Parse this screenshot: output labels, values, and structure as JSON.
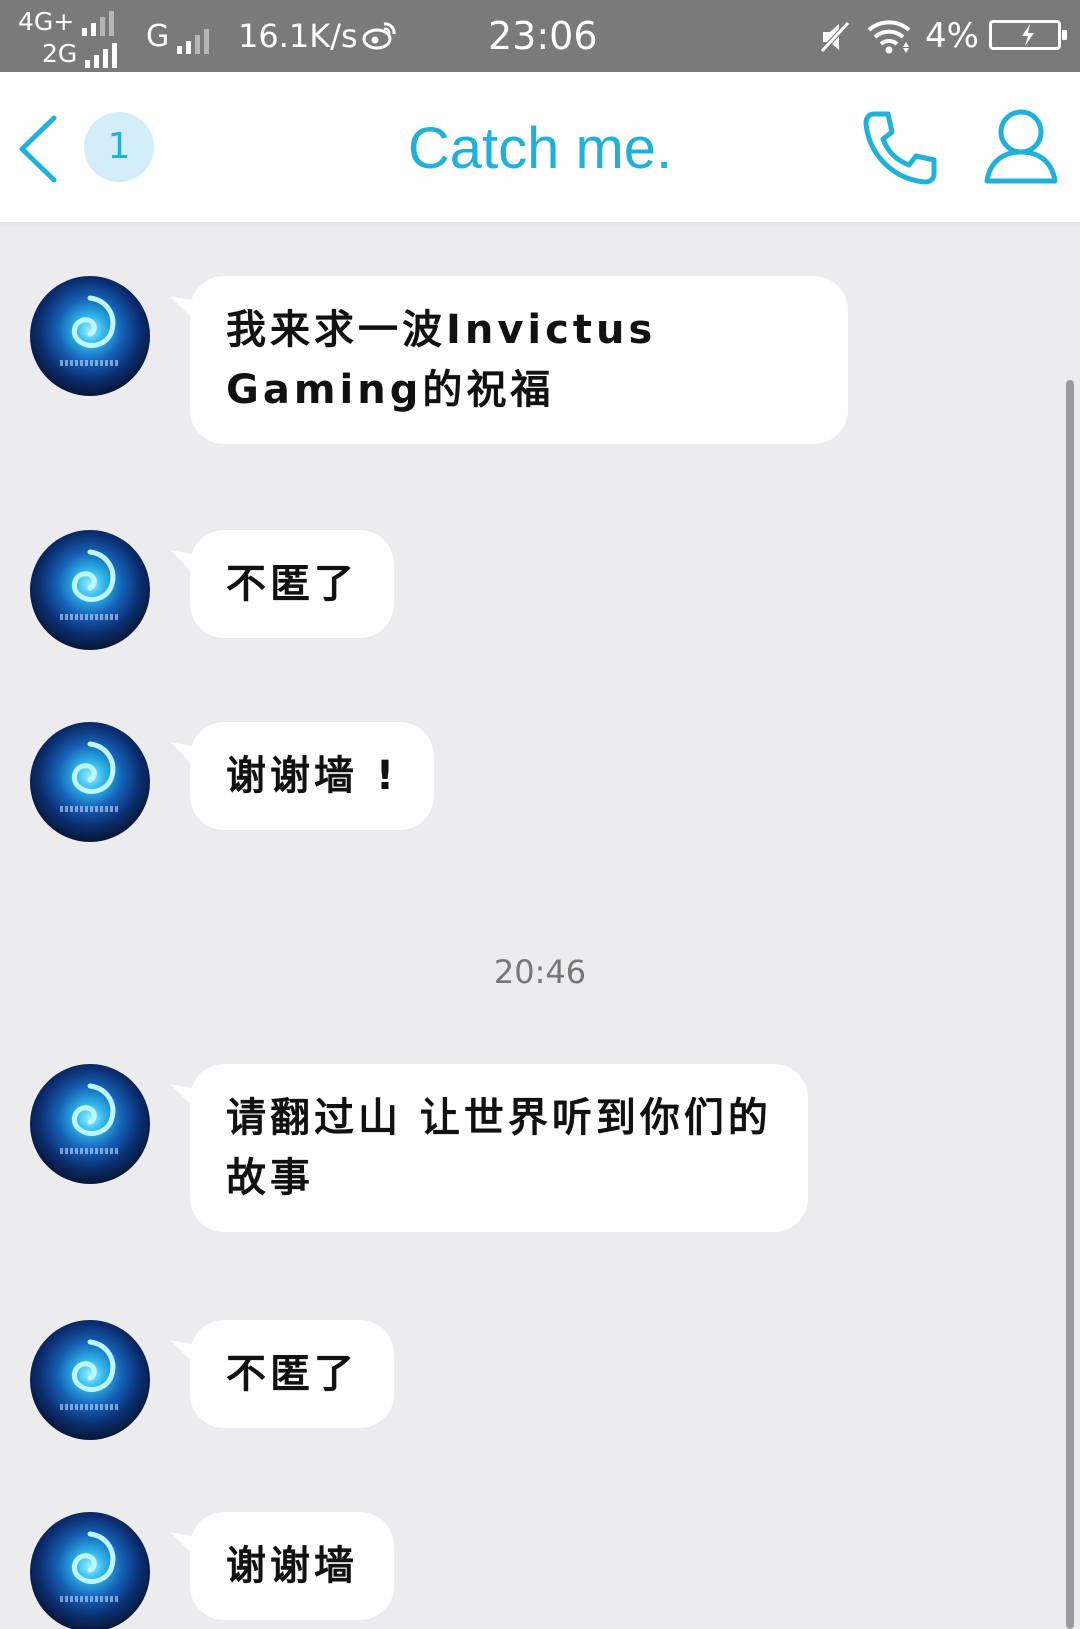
{
  "status_bar": {
    "network_top": "4G+",
    "network_bottom": "2G",
    "network_g": "G",
    "speed": "16.1K/s",
    "time": "23:06",
    "battery": "4%"
  },
  "header": {
    "unread_count": "1",
    "title": "Catch me."
  },
  "messages": [
    {
      "text": "我来求一波Invictus Gaming的祝福"
    },
    {
      "text": "不匿了"
    },
    {
      "text": "谢谢墙 !"
    },
    {
      "text": "请翻过山 让世界听到你们的故事"
    },
    {
      "text": "不匿了"
    },
    {
      "text": "谢谢墙"
    }
  ],
  "timestamp": "20:46",
  "colors": {
    "accent": "#1fb1dc",
    "background": "#ececee",
    "status_bar": "#7a7a7a",
    "bubble": "#ffffff"
  },
  "icons": [
    "weibo-icon",
    "mute-icon",
    "wifi-icon",
    "battery-icon",
    "back-icon",
    "phone-icon",
    "user-icon"
  ]
}
